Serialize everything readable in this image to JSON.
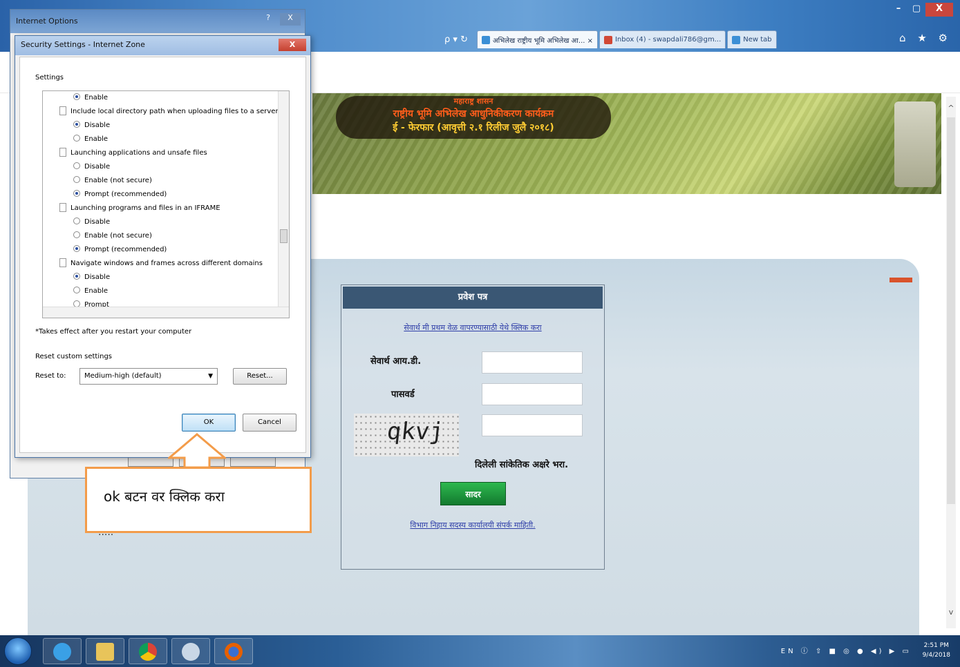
{
  "browser": {
    "tabs": [
      {
        "label": "अभिलेख राष्ट्रीय भूमि अभिलेख आ... ×"
      },
      {
        "label": "Inbox (4) - swapdali786@gm..."
      },
      {
        "label": "New tab"
      }
    ],
    "address_tools": "ρ ▾ ↻",
    "window_controls": {
      "minimize": "–",
      "maximize": "▢",
      "close": "X"
    },
    "right_icons": "⌂ ★ ⚙"
  },
  "banner": {
    "line1": "महाराष्ट्र शासन",
    "line2": "राष्ट्रीय भूमि अभिलेख आधुनिकीकरण कार्यक्रम",
    "line3": "ई - फेरफार (आवृत्ती २.१ रिलीज जुलै २०१८)"
  },
  "login": {
    "header": "प्रवेश पत्र",
    "link_top": "सेवार्थ मी प्रथम वेळ वापरण्यासाठी येथे क्लिक करा",
    "userid_label": "सेवार्थ आय.डी.",
    "password_label": "पासवर्ड",
    "captcha_text": "qkvj",
    "captcha_label": "दिलेली सांकेतिक अक्षरे भरा.",
    "submit_label": "सादर",
    "link_bottom": "विभाग निहाय सदस्य कार्यालयी संपर्क माहिती."
  },
  "callout": {
    "text": "ok बटन वर क्लिक करा",
    "partial_text": "....."
  },
  "internet_options": {
    "title": "Internet Options",
    "help": "?",
    "close": "X"
  },
  "security_dialog": {
    "title": "Security Settings - Internet Zone",
    "close": "X",
    "settings_label": "Settings",
    "rows": [
      {
        "kind": "opt",
        "label": "Enable",
        "checked": true
      },
      {
        "kind": "group",
        "label": "Include local directory path when uploading files to a server"
      },
      {
        "kind": "opt",
        "label": "Disable",
        "checked": true
      },
      {
        "kind": "opt",
        "label": "Enable",
        "checked": false
      },
      {
        "kind": "group",
        "label": "Launching applications and unsafe files"
      },
      {
        "kind": "opt",
        "label": "Disable",
        "checked": false
      },
      {
        "kind": "opt",
        "label": "Enable (not secure)",
        "checked": false
      },
      {
        "kind": "opt",
        "label": "Prompt (recommended)",
        "checked": true
      },
      {
        "kind": "group",
        "label": "Launching programs and files in an IFRAME"
      },
      {
        "kind": "opt",
        "label": "Disable",
        "checked": false
      },
      {
        "kind": "opt",
        "label": "Enable (not secure)",
        "checked": false
      },
      {
        "kind": "opt",
        "label": "Prompt (recommended)",
        "checked": true
      },
      {
        "kind": "group",
        "label": "Navigate windows and frames across different domains"
      },
      {
        "kind": "opt",
        "label": "Disable",
        "checked": true
      },
      {
        "kind": "opt",
        "label": "Enable",
        "checked": false
      },
      {
        "kind": "opt",
        "label": "Prompt",
        "checked": false
      }
    ],
    "takes_effect": "*Takes effect after you restart your computer",
    "reset_custom": "Reset custom settings",
    "reset_to_label": "Reset to:",
    "reset_to_value": "Medium-high (default)",
    "reset_button": "Reset...",
    "ok_button": "OK",
    "cancel_button": "Cancel"
  },
  "taskbar": {
    "tray": "EN ⓘ ⇧ ■ ◎ ● ◀) ▶ ▭",
    "time": "2:51 PM",
    "date": "9/4/2018"
  },
  "colors": {
    "callout_border": "#f39c4a",
    "login_header": "#3a5774",
    "submit_green": "#1f9a3c",
    "accent_orange": "#d9532c"
  }
}
